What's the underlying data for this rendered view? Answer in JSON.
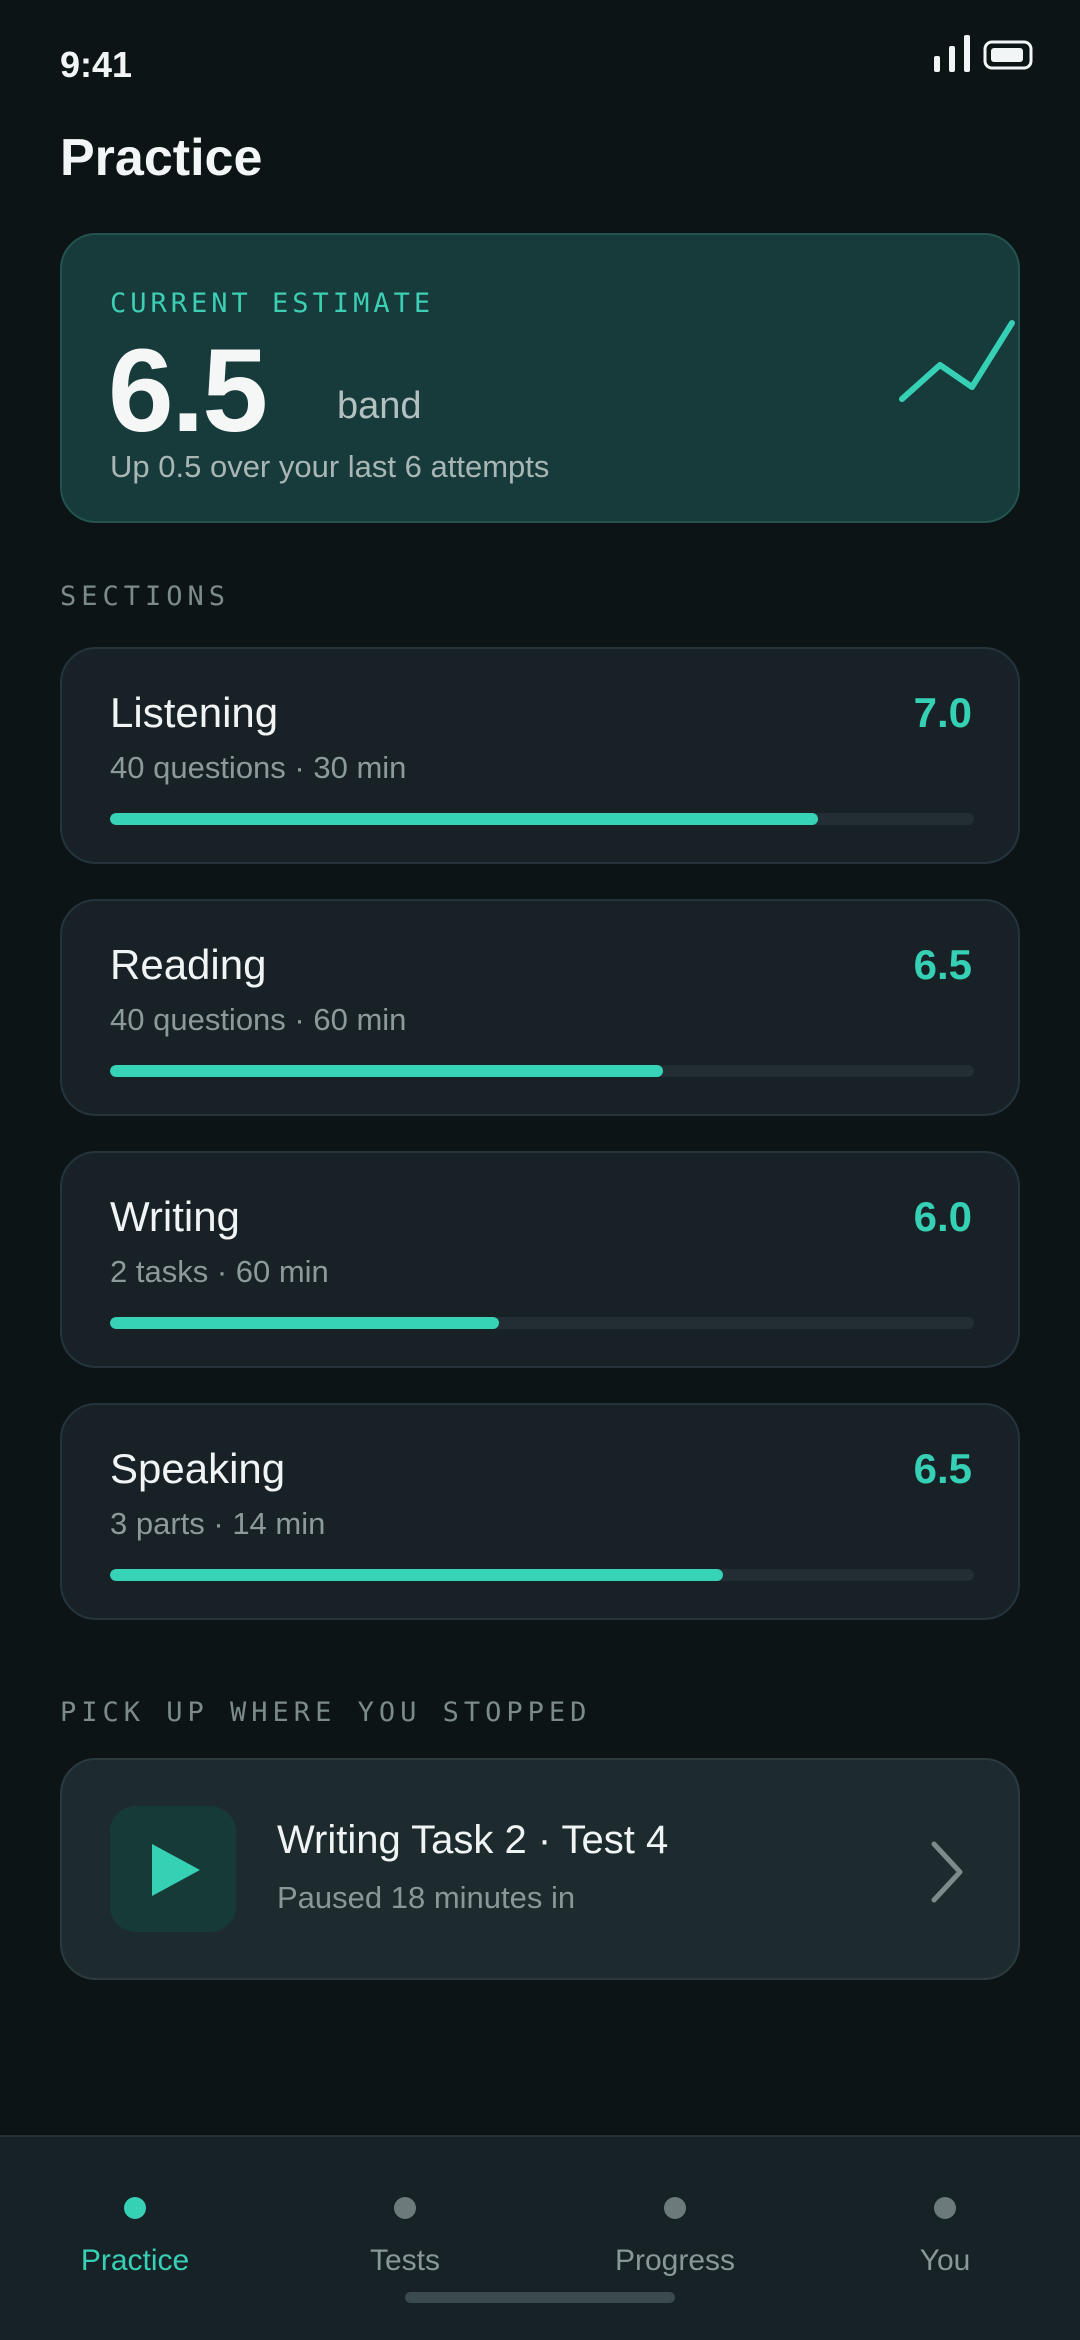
{
  "status_bar": {
    "time": "9:41",
    "icons": [
      "signal-icon",
      "battery-icon"
    ]
  },
  "page_title": "Practice",
  "estimate": {
    "eyebrow": "CURRENT ESTIMATE",
    "value": "6.5",
    "unit": "band",
    "note": "Up 0.5 over your last 6 attempts",
    "icon": "trend-up-icon"
  },
  "sections_heading": "SECTIONS",
  "sections": [
    {
      "name": "Listening",
      "meta": "40 questions · 30 min",
      "score": "7.0",
      "progress": 0.82
    },
    {
      "name": "Reading",
      "meta": "40 questions · 60 min",
      "score": "6.5",
      "progress": 0.64
    },
    {
      "name": "Writing",
      "meta": "2 tasks · 60 min",
      "score": "6.0",
      "progress": 0.45
    },
    {
      "name": "Speaking",
      "meta": "3 parts · 14 min",
      "score": "6.5",
      "progress": 0.71
    }
  ],
  "resume_heading": "PICK UP WHERE YOU STOPPED",
  "resume": {
    "title": "Writing Task 2 · Test 4",
    "subtitle": "Paused 18 minutes in",
    "icons": [
      "play-icon",
      "chevron-right-icon"
    ]
  },
  "nav": {
    "items": [
      {
        "label": "Practice",
        "active": true
      },
      {
        "label": "Tests",
        "active": false
      },
      {
        "label": "Progress",
        "active": false
      },
      {
        "label": "You",
        "active": false
      }
    ]
  },
  "colors": {
    "accent": "#36d0b5",
    "background": "#0c1416",
    "card": "#182226",
    "estimate_card": "#173a3a"
  }
}
